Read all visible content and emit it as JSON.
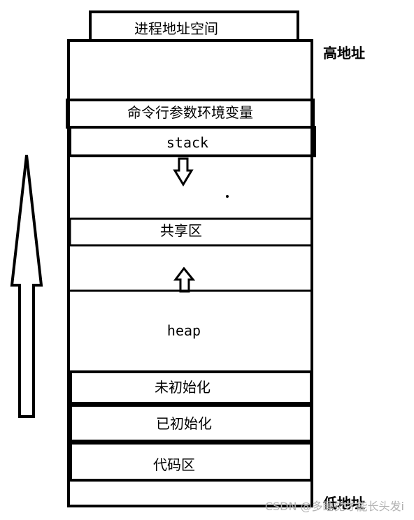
{
  "header": {
    "title": "进程地址空间"
  },
  "side_labels": {
    "high_address": "高地址",
    "low_address": "低地址"
  },
  "segments": {
    "cmdline_env": "命令行参数环境变量",
    "stack": "stack",
    "shared": "共享区",
    "heap": "heap",
    "bss": "未初始化",
    "data": "已初始化",
    "text": "代码区"
  },
  "watermark": "CSDN @多睡觉才能长头发i",
  "colors": {
    "line": "#000000",
    "background": "#ffffff",
    "watermark": "#b3b3b3"
  }
}
